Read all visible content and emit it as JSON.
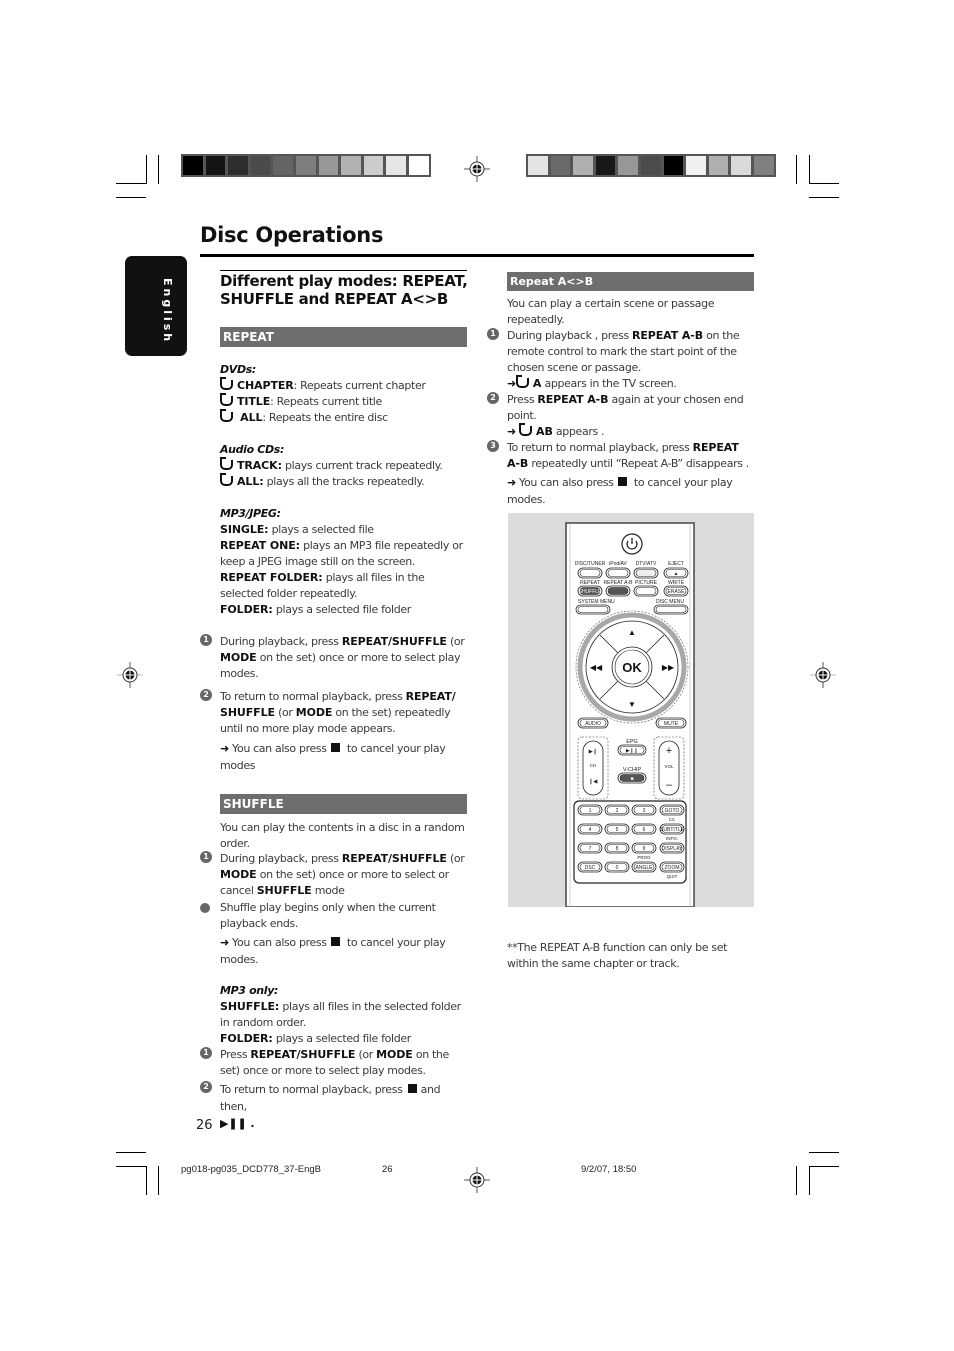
{
  "page": {
    "title": "Disc Operations",
    "language_tab": "English",
    "page_number": "26"
  },
  "left_column": {
    "heading_line1": "Different play modes: REPEAT,",
    "heading_line2": "SHUFFLE and REPEAT A<>B",
    "repeat": {
      "band": "REPEAT",
      "dvds_label": "DVDs:",
      "dvds": [
        {
          "term": "CHAPTER",
          "desc": ": Repeats current chapter"
        },
        {
          "term": "TITLE",
          "desc": ": Repeats current title"
        },
        {
          "term": "ALL",
          "desc": ": Repeats the entire disc"
        }
      ],
      "cds_label": "Audio CDs:",
      "cds": [
        {
          "term": "TRACK:",
          "desc": " plays current track repeatedly."
        },
        {
          "term": "ALL:",
          "desc": " plays all the tracks repeatedly."
        }
      ],
      "mp3_label": "MP3/JPEG:",
      "mp3": [
        {
          "term": "SINGLE:",
          "desc": " plays a selected file"
        },
        {
          "term": "REPEAT ONE:",
          "desc": " plays an MP3 file repeatedly or keep a JPEG image still on the screen."
        },
        {
          "term": "REPEAT FOLDER:",
          "desc": " plays all files in the selected folder repeatedly."
        },
        {
          "term": "FOLDER:",
          "desc": " plays a selected file folder"
        }
      ],
      "step1": {
        "num": "1",
        "a": "During playback, press ",
        "b1": "REPEAT/SHUFFLE",
        "c": " (or ",
        "b2": "MODE",
        "d": " on the set) once or more to select play modes."
      },
      "step2": {
        "num": "2",
        "a": "To return to normal playback, press ",
        "b1": "REPEAT/ SHUFFLE",
        "c": " (or ",
        "b2": "MODE",
        "d": " on the set) repeatedly until no more play mode appears."
      },
      "note": {
        "a": "You can also press",
        "b": "to cancel your play modes"
      }
    },
    "shuffle": {
      "band": "SHUFFLE",
      "intro": "You can play the contents in a disc in a random order.",
      "step1": {
        "num": "1",
        "a": "During playback, press ",
        "b1": "REPEAT/SHUFFLE",
        "c": " (or ",
        "b2": "MODE",
        "d": " on the set) once or more to select or cancel ",
        "b3": "SHUFFLE",
        "e": " mode"
      },
      "bullet": "Shuffle play begins only when the current playback ends.",
      "note": {
        "a": "You can also press",
        "b": "to cancel your play modes."
      },
      "mp3_label": "MP3 only:",
      "mp3": [
        {
          "term": "SHUFFLE:",
          "desc": " plays all files in the selected folder in random order."
        },
        {
          "term": "FOLDER:",
          "desc": " plays a selected file folder"
        }
      ],
      "step_a": {
        "num": "1",
        "a": "Press ",
        "b1": "REPEAT/SHUFFLE",
        "c": " (or ",
        "b2": "MODE",
        "d": " on the set) once or more to select play modes."
      },
      "step_b": {
        "num": "2",
        "a": "To return to normal playback, press",
        "b": "and then,",
        "c": "▶❚❚ ."
      }
    }
  },
  "right_column": {
    "band": "Repeat A<>B",
    "intro": "You can play a certain scene or passage repeatedly.",
    "step1": {
      "num": "1",
      "a": "During playback , press ",
      "b1": "REPEAT A-B",
      "c": " on the remote control to mark the start point of the chosen scene or passage."
    },
    "step1_result": {
      "term": "A",
      "desc": " appears in the TV screen."
    },
    "step2": {
      "num": "2",
      "a": "Press ",
      "b1": "REPEAT A-B",
      "c": " again at your chosen end point."
    },
    "step2_result": {
      "term": "AB",
      "desc": " appears ."
    },
    "step3": {
      "num": "3",
      "a": "To return to normal playback, press ",
      "b1": "REPEAT A-B",
      "c": " repeatedly until “Repeat A-B” disappears ."
    },
    "note": {
      "a": "You can also press",
      "b": "to cancel your play modes."
    },
    "footnote": "**The REPEAT A-B function can only be set within the same chapter or track."
  },
  "remote": {
    "row1": [
      "DISC/TUNER",
      "iPod/AV",
      "DTV/ATV",
      "EJECT"
    ],
    "row2": [
      "REPEAT",
      "REPEAT A-B",
      "PICTURE",
      "WRITE"
    ],
    "row2_inner": [
      "SHUFFLE",
      "",
      "",
      "ERASE"
    ],
    "menus": [
      "SYSTEM MENU",
      "DISC MENU"
    ],
    "ok": "OK",
    "audio": "AUDIO",
    "mute": "MUTE",
    "epg": "EPG",
    "vchip": "V-CHIP",
    "ch": "CH",
    "vol": "VOL",
    "keypad": [
      [
        "1",
        "2",
        "3",
        "GOTO"
      ],
      [
        "4",
        "5",
        "6",
        "SUBTITLE"
      ],
      [
        "7",
        "8",
        "9",
        "DISPLAY"
      ],
      [
        "DSC",
        "0",
        "ANGLE",
        "ZOOM"
      ]
    ],
    "keypad_labels": [
      "CC",
      "INFO.",
      "PROG",
      "QUIT"
    ]
  },
  "footer": {
    "file": "pg018-pg035_DCD778_37-EngB",
    "page": "26",
    "date": "9/2/07, 18:50"
  },
  "colors": {
    "band": "#6e6e6e",
    "tab": "#111111"
  }
}
